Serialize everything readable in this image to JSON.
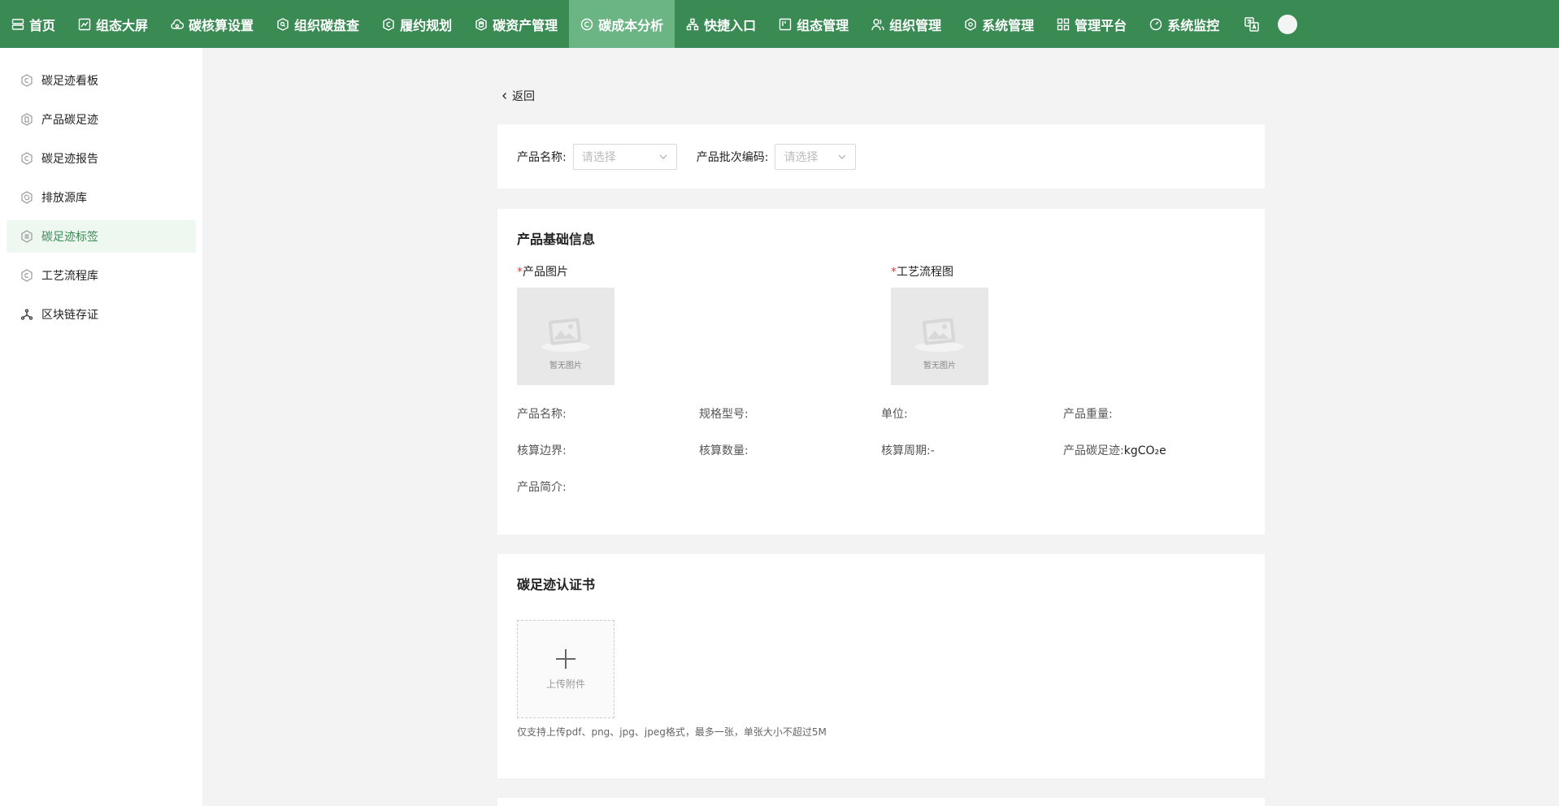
{
  "nav": {
    "items": [
      {
        "label": "首页",
        "icon": "home-icon"
      },
      {
        "label": "组态大屏",
        "icon": "chart-icon"
      },
      {
        "label": "碳核算设置",
        "icon": "cloud-icon"
      },
      {
        "label": "组织碳盘查",
        "icon": "search-shield-icon"
      },
      {
        "label": "履约规划",
        "icon": "copyright-shield-icon"
      },
      {
        "label": "碳资产管理",
        "icon": "database-shield-icon"
      },
      {
        "label": "碳成本分析",
        "icon": "copyright-circle-icon"
      },
      {
        "label": "快捷入口",
        "icon": "hierarchy-icon"
      },
      {
        "label": "组态管理",
        "icon": "board-icon"
      },
      {
        "label": "组织管理",
        "icon": "users-icon"
      },
      {
        "label": "系统管理",
        "icon": "gear-icon"
      },
      {
        "label": "管理平台",
        "icon": "grid-icon"
      },
      {
        "label": "系统监控",
        "icon": "gauge-icon"
      }
    ],
    "active_index": 6,
    "accent": "#3a8a54",
    "active_bg": "#6bb484"
  },
  "sidebar": {
    "items": [
      {
        "label": "碳足迹看板",
        "icon": "hex-c-icon"
      },
      {
        "label": "产品碳足迹",
        "icon": "hex-doc-icon"
      },
      {
        "label": "碳足迹报告",
        "icon": "hex-c-icon"
      },
      {
        "label": "排放源库",
        "icon": "hex-recycle-icon"
      },
      {
        "label": "碳足迹标签",
        "icon": "hex-list-icon"
      },
      {
        "label": "工艺流程库",
        "icon": "hex-c-icon"
      },
      {
        "label": "区块链存证",
        "icon": "blockchain-icon"
      }
    ],
    "active_index": 4
  },
  "back_label": "返回",
  "filter": {
    "product_name_label": "产品名称:",
    "product_name_placeholder": "请选择",
    "batch_code_label": "产品批次编码:",
    "batch_code_placeholder": "请选择"
  },
  "info": {
    "title": "产品基础信息",
    "required_mark": "*",
    "product_image_label": "产品图片",
    "process_image_label": "工艺流程图",
    "no_image_caption": "暂无图片",
    "fields": {
      "product_name": "产品名称:",
      "spec_model": "规格型号:",
      "unit": "单位:",
      "product_weight": "产品重量:",
      "boundary": "核算边界:",
      "quantity": "核算数量:",
      "period": "核算周期:-",
      "footprint_label": "产品碳足迹:",
      "footprint_unit": "kgCO₂e",
      "intro": "产品简介:"
    }
  },
  "cert": {
    "title": "碳足迹认证书",
    "upload_caption": "上传附件",
    "hint": "仅支持上传pdf、png、jpg、jpeg格式，最多一张，单张大小不超过5M"
  }
}
